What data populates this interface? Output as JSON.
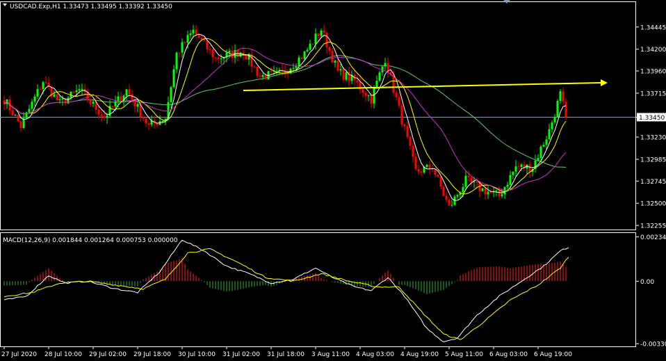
{
  "window": {
    "symbol_header": "USDCAD.Exp,H1  1.33473 1.33495 1.33392 1.33450",
    "indicator_header": "MACD(12,26,9) 0.001844 0.001264 0.000753 0.000000"
  },
  "colors": {
    "background": "#000000",
    "grid_border": "#ffffff",
    "bull_candle": "#00ff00",
    "bear_candle": "#ff0000",
    "ma_fast": "#ffffff",
    "ma_mid": "#ffff00",
    "ma_slow": "#cc33cc",
    "ma_long": "#55cc77",
    "trend_arrow": "#ffff00",
    "macd_hist_pos": "#ff2222",
    "macd_hist_neg": "#33aa33",
    "current_price_line": "#8899aa"
  },
  "chart_data": [
    {
      "type": "candlestick",
      "title": "USDCAD.Exp,H1  1.33473 1.33495 1.33392 1.33450",
      "y_ticks": [
        "1.34445",
        "1.34200",
        "1.33960",
        "1.33715",
        "1.33450",
        "1.33230",
        "1.32985",
        "1.32745",
        "1.32500",
        "1.32255"
      ],
      "y_tick_values": [
        1.34445,
        1.342,
        1.3396,
        1.33715,
        1.3345,
        1.3323,
        1.32985,
        1.32745,
        1.325,
        1.32255
      ],
      "ylim": [
        1.3221,
        1.3472
      ],
      "current_price": 1.3345,
      "x_ticks": [
        "27 Jul 2020",
        "28 Jul 10:00",
        "29 Jul 02:00",
        "29 Jul 18:00",
        "30 Jul 10:00",
        "31 Jul 02:00",
        "31 Jul 18:00",
        "3 Aug 11:00",
        "4 Aug 03:00",
        "4 Aug 19:00",
        "5 Aug 11:00",
        "6 Aug 03:00",
        "6 Aug 19:00"
      ],
      "x_tick_bars": [
        0,
        16,
        32,
        48,
        64,
        80,
        96,
        112,
        128,
        144,
        160,
        176,
        192
      ],
      "bar_count": 203,
      "anchors": [
        {
          "bar": 0,
          "price": 1.3365
        },
        {
          "bar": 6,
          "price": 1.3335
        },
        {
          "bar": 14,
          "price": 1.3385
        },
        {
          "bar": 20,
          "price": 1.336
        },
        {
          "bar": 27,
          "price": 1.3375
        },
        {
          "bar": 36,
          "price": 1.3345
        },
        {
          "bar": 44,
          "price": 1.3375
        },
        {
          "bar": 52,
          "price": 1.3335
        },
        {
          "bar": 58,
          "price": 1.3345
        },
        {
          "bar": 62,
          "price": 1.3415
        },
        {
          "bar": 68,
          "price": 1.344
        },
        {
          "bar": 76,
          "price": 1.341
        },
        {
          "bar": 86,
          "price": 1.3418
        },
        {
          "bar": 92,
          "price": 1.339
        },
        {
          "bar": 100,
          "price": 1.3393
        },
        {
          "bar": 108,
          "price": 1.3415
        },
        {
          "bar": 114,
          "price": 1.3442
        },
        {
          "bar": 120,
          "price": 1.3395
        },
        {
          "bar": 126,
          "price": 1.3385
        },
        {
          "bar": 132,
          "price": 1.3365
        },
        {
          "bar": 137,
          "price": 1.341
        },
        {
          "bar": 141,
          "price": 1.3365
        },
        {
          "bar": 148,
          "price": 1.3285
        },
        {
          "bar": 154,
          "price": 1.329
        },
        {
          "bar": 160,
          "price": 1.3245
        },
        {
          "bar": 166,
          "price": 1.3275
        },
        {
          "bar": 172,
          "price": 1.3265
        },
        {
          "bar": 178,
          "price": 1.3258
        },
        {
          "bar": 184,
          "price": 1.329
        },
        {
          "bar": 190,
          "price": 1.329
        },
        {
          "bar": 196,
          "price": 1.333
        },
        {
          "bar": 200,
          "price": 1.337
        },
        {
          "bar": 202,
          "price": 1.3345
        }
      ],
      "moving_averages": [
        {
          "role": "fast",
          "period": 5
        },
        {
          "role": "mid",
          "period": 10
        },
        {
          "role": "slow",
          "period": 25
        },
        {
          "role": "long",
          "period": 60
        }
      ],
      "trend_arrow": {
        "from": {
          "bar": 86,
          "price": 1.33745
        },
        "to": {
          "bar": 217,
          "price": 1.3383
        }
      }
    },
    {
      "type": "macd",
      "title": "MACD(12,26,9) 0.001844 0.001264 0.000753 0.000000",
      "y_ticks": [
        "0.002344",
        "0.00",
        "-0.003307"
      ],
      "y_tick_values": [
        0.002344,
        0.0,
        -0.003307
      ],
      "ylim": [
        -0.00345,
        0.00255
      ],
      "main_line": [
        {
          "bar": 0,
          "value": -0.001
        },
        {
          "bar": 8,
          "value": -0.0008
        },
        {
          "bar": 16,
          "value": 0.0003
        },
        {
          "bar": 22,
          "value": -0.0001
        },
        {
          "bar": 30,
          "value": 0.0
        },
        {
          "bar": 40,
          "value": -0.0004
        },
        {
          "bar": 48,
          "value": -0.0006
        },
        {
          "bar": 56,
          "value": 0.0005
        },
        {
          "bar": 64,
          "value": 0.0022
        },
        {
          "bar": 72,
          "value": 0.0016
        },
        {
          "bar": 80,
          "value": 0.0008
        },
        {
          "bar": 88,
          "value": 0.0004
        },
        {
          "bar": 96,
          "value": -0.0001
        },
        {
          "bar": 104,
          "value": 0.0001
        },
        {
          "bar": 112,
          "value": 0.0007
        },
        {
          "bar": 118,
          "value": 0.0002
        },
        {
          "bar": 126,
          "value": -0.0003
        },
        {
          "bar": 132,
          "value": -0.0005
        },
        {
          "bar": 138,
          "value": 0.0002
        },
        {
          "bar": 144,
          "value": -0.0008
        },
        {
          "bar": 152,
          "value": -0.0025
        },
        {
          "bar": 158,
          "value": -0.0032
        },
        {
          "bar": 163,
          "value": -0.003
        },
        {
          "bar": 170,
          "value": -0.0018
        },
        {
          "bar": 178,
          "value": -0.0008
        },
        {
          "bar": 186,
          "value": 0.0
        },
        {
          "bar": 194,
          "value": 0.0008
        },
        {
          "bar": 200,
          "value": 0.0016
        },
        {
          "bar": 203,
          "value": 0.0018
        }
      ],
      "signal_line": [
        {
          "bar": 0,
          "value": -0.0008
        },
        {
          "bar": 10,
          "value": -0.0006
        },
        {
          "bar": 20,
          "value": -0.0001
        },
        {
          "bar": 30,
          "value": 0.0
        },
        {
          "bar": 40,
          "value": -0.0002
        },
        {
          "bar": 50,
          "value": -0.0004
        },
        {
          "bar": 58,
          "value": 0.0001
        },
        {
          "bar": 66,
          "value": 0.0015
        },
        {
          "bar": 74,
          "value": 0.0017
        },
        {
          "bar": 84,
          "value": 0.001
        },
        {
          "bar": 94,
          "value": 0.0002
        },
        {
          "bar": 104,
          "value": 0.0
        },
        {
          "bar": 114,
          "value": 0.0004
        },
        {
          "bar": 124,
          "value": 0.0
        },
        {
          "bar": 134,
          "value": -0.0003
        },
        {
          "bar": 142,
          "value": -0.0003
        },
        {
          "bar": 150,
          "value": -0.0016
        },
        {
          "bar": 158,
          "value": -0.0028
        },
        {
          "bar": 164,
          "value": -0.0031
        },
        {
          "bar": 172,
          "value": -0.0022
        },
        {
          "bar": 182,
          "value": -0.001
        },
        {
          "bar": 192,
          "value": -0.0002
        },
        {
          "bar": 200,
          "value": 0.0007
        },
        {
          "bar": 203,
          "value": 0.0013
        }
      ]
    }
  ]
}
